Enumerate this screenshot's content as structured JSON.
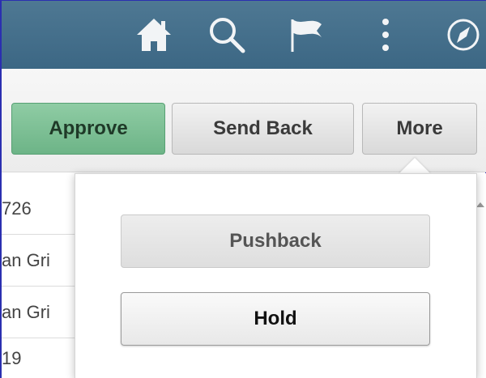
{
  "header": {
    "icons": {
      "home": "home-icon",
      "search": "search-icon",
      "flag": "flag-icon",
      "actions": "more-vertical-icon",
      "navbar": "compass-icon"
    },
    "bg_color": "#46708d"
  },
  "toolbar": {
    "approve_label": "Approve",
    "send_back_label": "Send Back",
    "more_label": "More",
    "approve_color": "#7fc199"
  },
  "list": {
    "rows": [
      "726",
      "an Gri",
      "an Gri",
      "19"
    ]
  },
  "popup": {
    "pushback_label": "Pushback",
    "hold_label": "Hold"
  }
}
